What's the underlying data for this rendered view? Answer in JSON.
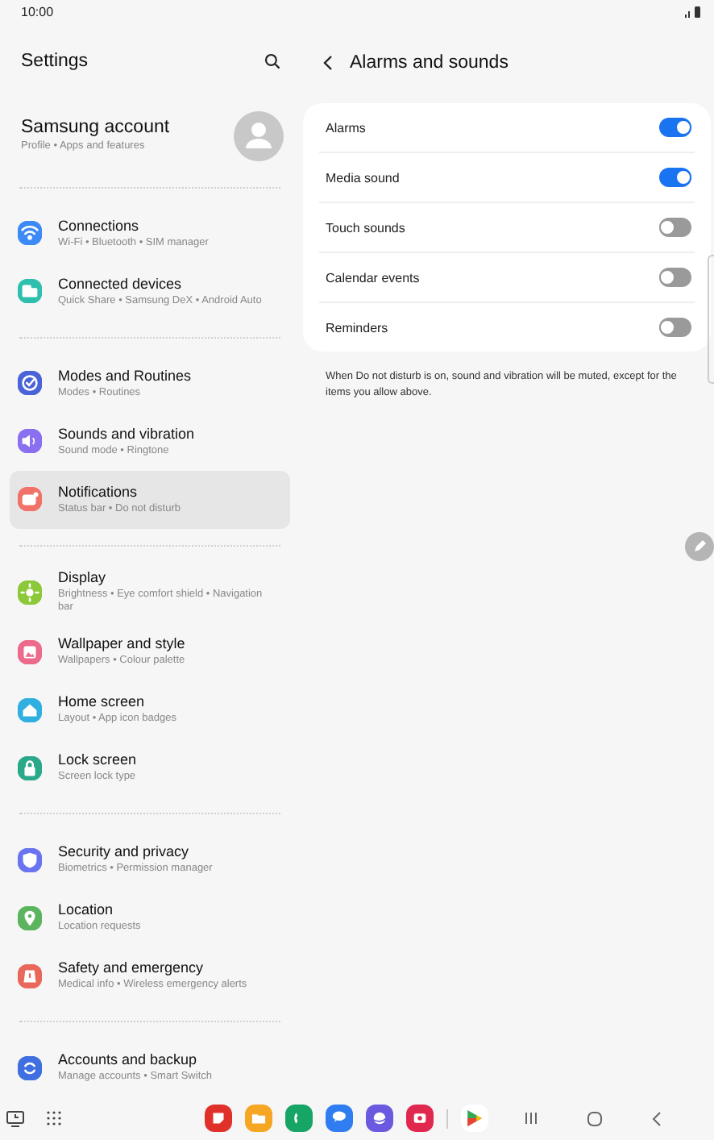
{
  "status_bar": {
    "time": "10:00"
  },
  "settings": {
    "title": "Settings",
    "account": {
      "title": "Samsung account",
      "subtitle": "Profile  •  Apps and features"
    },
    "groups": [
      {
        "items": [
          {
            "title": "Connections",
            "subtitle": "Wi-Fi  •  Bluetooth  •  SIM manager",
            "selected": false
          },
          {
            "title": "Connected devices",
            "subtitle": "Quick Share  •  Samsung DeX  •  Android Auto",
            "selected": false
          }
        ]
      },
      {
        "items": [
          {
            "title": "Modes and Routines",
            "subtitle": "Modes  •  Routines",
            "selected": false
          },
          {
            "title": "Sounds and vibration",
            "subtitle": "Sound mode  •  Ringtone",
            "selected": false
          },
          {
            "title": "Notifications",
            "subtitle": "Status bar  •  Do not disturb",
            "selected": true
          }
        ]
      },
      {
        "items": [
          {
            "title": "Display",
            "subtitle": "Brightness  •  Eye comfort shield  •  Navigation bar",
            "selected": false
          },
          {
            "title": "Wallpaper and style",
            "subtitle": "Wallpapers  •  Colour palette",
            "selected": false
          },
          {
            "title": "Home screen",
            "subtitle": "Layout  •  App icon badges",
            "selected": false
          },
          {
            "title": "Lock screen",
            "subtitle": "Screen lock type",
            "selected": false
          }
        ]
      },
      {
        "items": [
          {
            "title": "Security and privacy",
            "subtitle": "Biometrics  •  Permission manager",
            "selected": false
          },
          {
            "title": "Location",
            "subtitle": "Location requests",
            "selected": false
          },
          {
            "title": "Safety and emergency",
            "subtitle": "Medical info  •  Wireless emergency alerts",
            "selected": false
          }
        ]
      },
      {
        "items": [
          {
            "title": "Accounts and backup",
            "subtitle": "Manage accounts  •  Smart Switch",
            "selected": false
          }
        ]
      }
    ]
  },
  "detail": {
    "title": "Alarms and sounds",
    "toggles": [
      {
        "label": "Alarms",
        "on": true
      },
      {
        "label": "Media sound",
        "on": true
      },
      {
        "label": "Touch sounds",
        "on": false
      },
      {
        "label": "Calendar events",
        "on": false
      },
      {
        "label": "Reminders",
        "on": false
      }
    ],
    "note": "When Do not disturb is on, sound and vibration will be muted, except for the items you allow above."
  }
}
